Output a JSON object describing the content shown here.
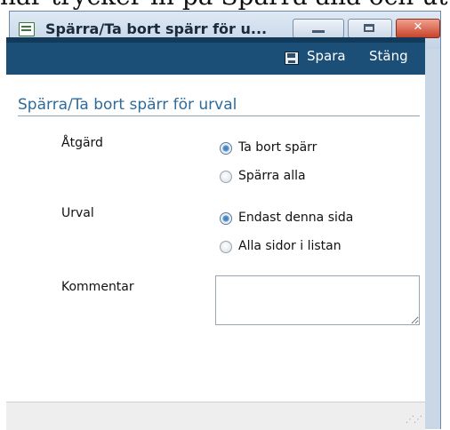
{
  "background_text": "har trycker in på Spärra alla och utta",
  "window": {
    "title": "Spärra/Ta bort spärr för u...",
    "icon": "form-window-icon",
    "controls": [
      "minimize-icon",
      "maximize-icon",
      "close-icon"
    ]
  },
  "toolbar": {
    "save_icon": "save-floppy-icon",
    "save_label": "Spara",
    "close_label": "Stäng"
  },
  "section": {
    "title": "Spärra/Ta bort spärr för urval"
  },
  "form": {
    "action": {
      "label": "Åtgärd",
      "options": [
        {
          "label": "Ta bort spärr",
          "checked": true
        },
        {
          "label": "Spärra alla",
          "checked": false
        }
      ]
    },
    "selection": {
      "label": "Urval",
      "options": [
        {
          "label": "Endast denna sida",
          "checked": true
        },
        {
          "label": "Alla sidor i listan",
          "checked": false
        }
      ]
    },
    "comment": {
      "label": "Kommentar",
      "value": ""
    }
  },
  "colors": {
    "toolbar_bg": "#1b4f78",
    "section_title": "#2d6b9c",
    "titlebar": "#c9d7e7"
  }
}
